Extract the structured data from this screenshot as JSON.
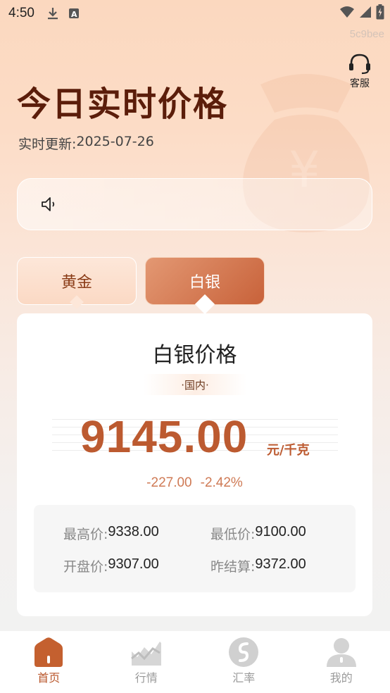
{
  "status_bar": {
    "time": "4:50"
  },
  "watermark": "5c9bee",
  "service": {
    "label": "客服"
  },
  "header": {
    "title": "今日实时价格",
    "update_prefix": "实时更新:",
    "update_date": "2025-07-26"
  },
  "tabs": [
    {
      "label": "黄金",
      "active": false
    },
    {
      "label": "白银",
      "active": true
    }
  ],
  "card": {
    "title": "白银价格",
    "region": "·国内·",
    "price": "9145.00",
    "unit": "元/千克",
    "change_abs": "-227.00",
    "change_pct": "-2.42%",
    "stats": {
      "high_label": "最高价:",
      "high_value": "9338.00",
      "low_label": "最低价:",
      "low_value": "9100.00",
      "open_label": "开盘价:",
      "open_value": "9307.00",
      "settle_label": "昨结算:",
      "settle_value": "9372.00"
    }
  },
  "bottom_nav": [
    {
      "label": "首页",
      "icon": "home-icon",
      "active": true
    },
    {
      "label": "行情",
      "icon": "chart-icon",
      "active": false
    },
    {
      "label": "汇率",
      "icon": "exchange-icon",
      "active": false
    },
    {
      "label": "我的",
      "icon": "user-icon",
      "active": false
    }
  ],
  "colors": {
    "accent": "#bc5a30",
    "title": "#5b1d0a",
    "change": "#cf7a55"
  }
}
